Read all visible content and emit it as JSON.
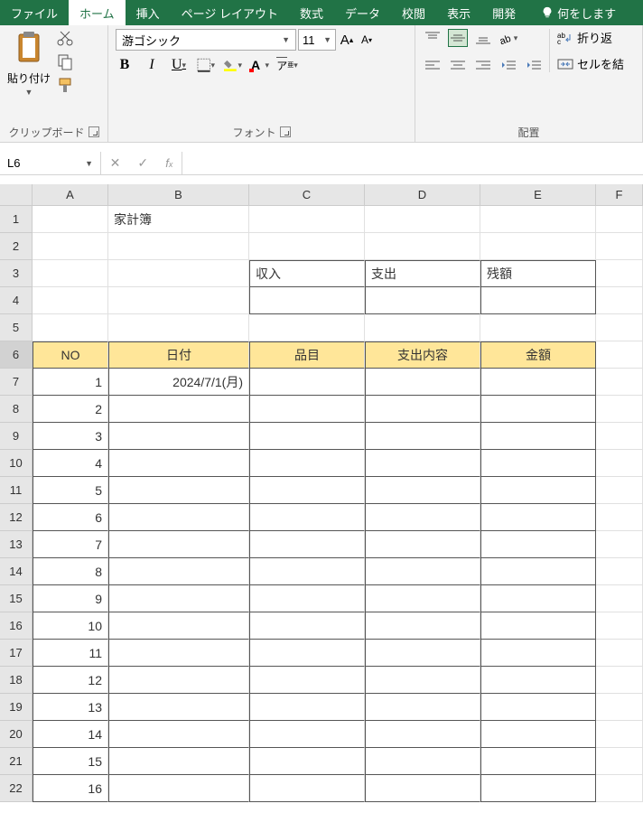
{
  "tabs": {
    "file": "ファイル",
    "home": "ホーム",
    "insert": "挿入",
    "pageLayout": "ページ レイアウト",
    "formulas": "数式",
    "data": "データ",
    "review": "校閲",
    "view": "表示",
    "developer": "開発",
    "tell": "何をします"
  },
  "ribbon": {
    "clipboard": {
      "paste": "貼り付け",
      "label": "クリップボード"
    },
    "font": {
      "name": "游ゴシック",
      "size": "11",
      "label": "フォント"
    },
    "alignment": {
      "label": "配置",
      "wrap": "折り返",
      "merge": "セルを結"
    }
  },
  "nameBox": "L6",
  "columns": [
    "A",
    "B",
    "C",
    "D",
    "E",
    "F"
  ],
  "rows": [
    "1",
    "2",
    "3",
    "4",
    "5",
    "6",
    "7",
    "8",
    "9",
    "10",
    "11",
    "12",
    "13",
    "14",
    "15",
    "16",
    "17",
    "18",
    "19",
    "20",
    "21",
    "22"
  ],
  "sheet": {
    "title": "家計簿",
    "row3": {
      "c": "収入",
      "d": "支出",
      "e": "残額"
    },
    "headers": {
      "a": "NO",
      "b": "日付",
      "c": "品目",
      "d": "支出内容",
      "e": "金額"
    },
    "firstDate": "2024/7/1(月)",
    "numbers": [
      "1",
      "2",
      "3",
      "4",
      "5",
      "6",
      "7",
      "8",
      "9",
      "10",
      "11",
      "12",
      "13",
      "14",
      "15",
      "16"
    ]
  }
}
